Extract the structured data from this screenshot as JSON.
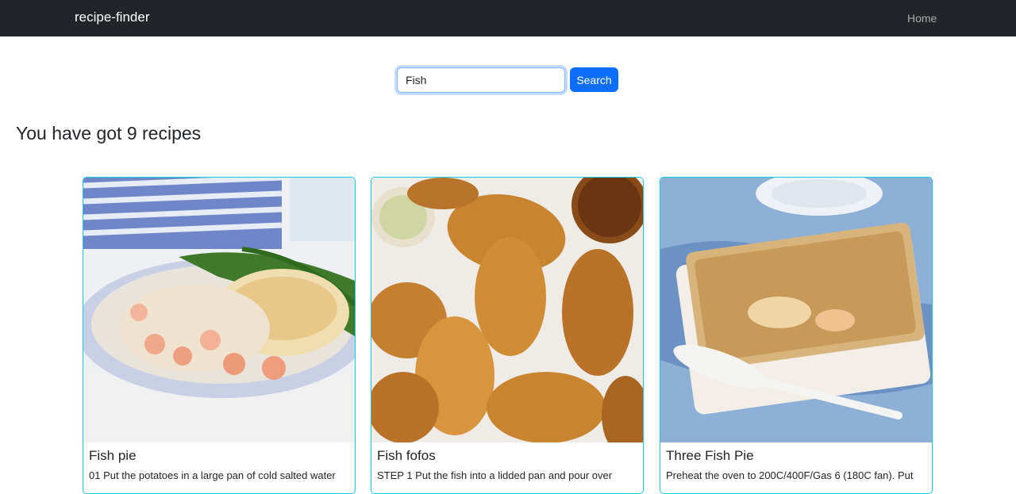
{
  "navbar": {
    "brand": "recipe-finder",
    "home_link": "Home"
  },
  "search": {
    "value": "Fish",
    "button_label": "Search"
  },
  "results": {
    "heading": "You have got 9 recipes",
    "cards": [
      {
        "title": "Fish pie",
        "description": "01 Put the potatoes in a large pan of cold salted water"
      },
      {
        "title": "Fish fofos",
        "description": "STEP 1 Put the fish into a lidded pan and pour over"
      },
      {
        "title": "Three Fish Pie",
        "description": "Preheat the oven to 200C/400F/Gas 6 (180C fan). Put"
      }
    ]
  },
  "colors": {
    "navbar_bg": "#212529",
    "primary": "#0d6efd",
    "card_border": "#0dcaf0"
  }
}
